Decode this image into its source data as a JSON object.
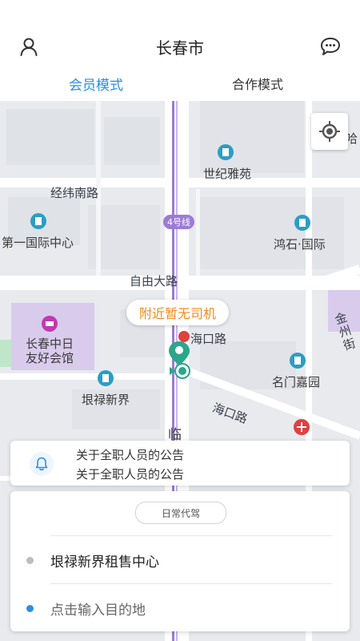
{
  "header": {
    "city_title": "长春市",
    "profile_icon": "user-icon",
    "message_icon": "chat-bubble-icon",
    "tabs": [
      {
        "label": "会员模式",
        "active": true
      },
      {
        "label": "合作模式",
        "active": false
      }
    ],
    "accent_color": "#2a8fe0"
  },
  "map": {
    "labels": {
      "shiji_yayuan": "世纪雅苑",
      "jingwei_nanlu": "经纬南路",
      "line4": "4号线",
      "diyi_guoji": "第一国际中心",
      "hongshi_guoji": "鸿石·国际",
      "ziyou_dalu": "自由大路",
      "changchun_zhongri": "长春中日",
      "youhao_huiguan": "友好会馆",
      "haikou_lu": "海口路",
      "haikou_lu_2": "海口路",
      "jinzhou_jie": "金州街",
      "mingmen_jiayuan": "名门嘉园",
      "genlu_xinjie": "垠禄新界",
      "lin": "临",
      "ha": "哈"
    },
    "nearby_status": "附近暂无司机",
    "nearby_color": "#f08c1a",
    "locate_icon": "crosshair-locate-icon"
  },
  "notice": {
    "icon": "bell-icon",
    "line1": "关于全职人员的公告",
    "line2": "关于全职人员的公告"
  },
  "trip": {
    "service_type": "日常代驾",
    "origin": "垠禄新界租售中心",
    "destination_placeholder": "点击输入目的地",
    "origin_dot_color": "#bdbdbd",
    "destination_dot_color": "#2a8fe0"
  }
}
